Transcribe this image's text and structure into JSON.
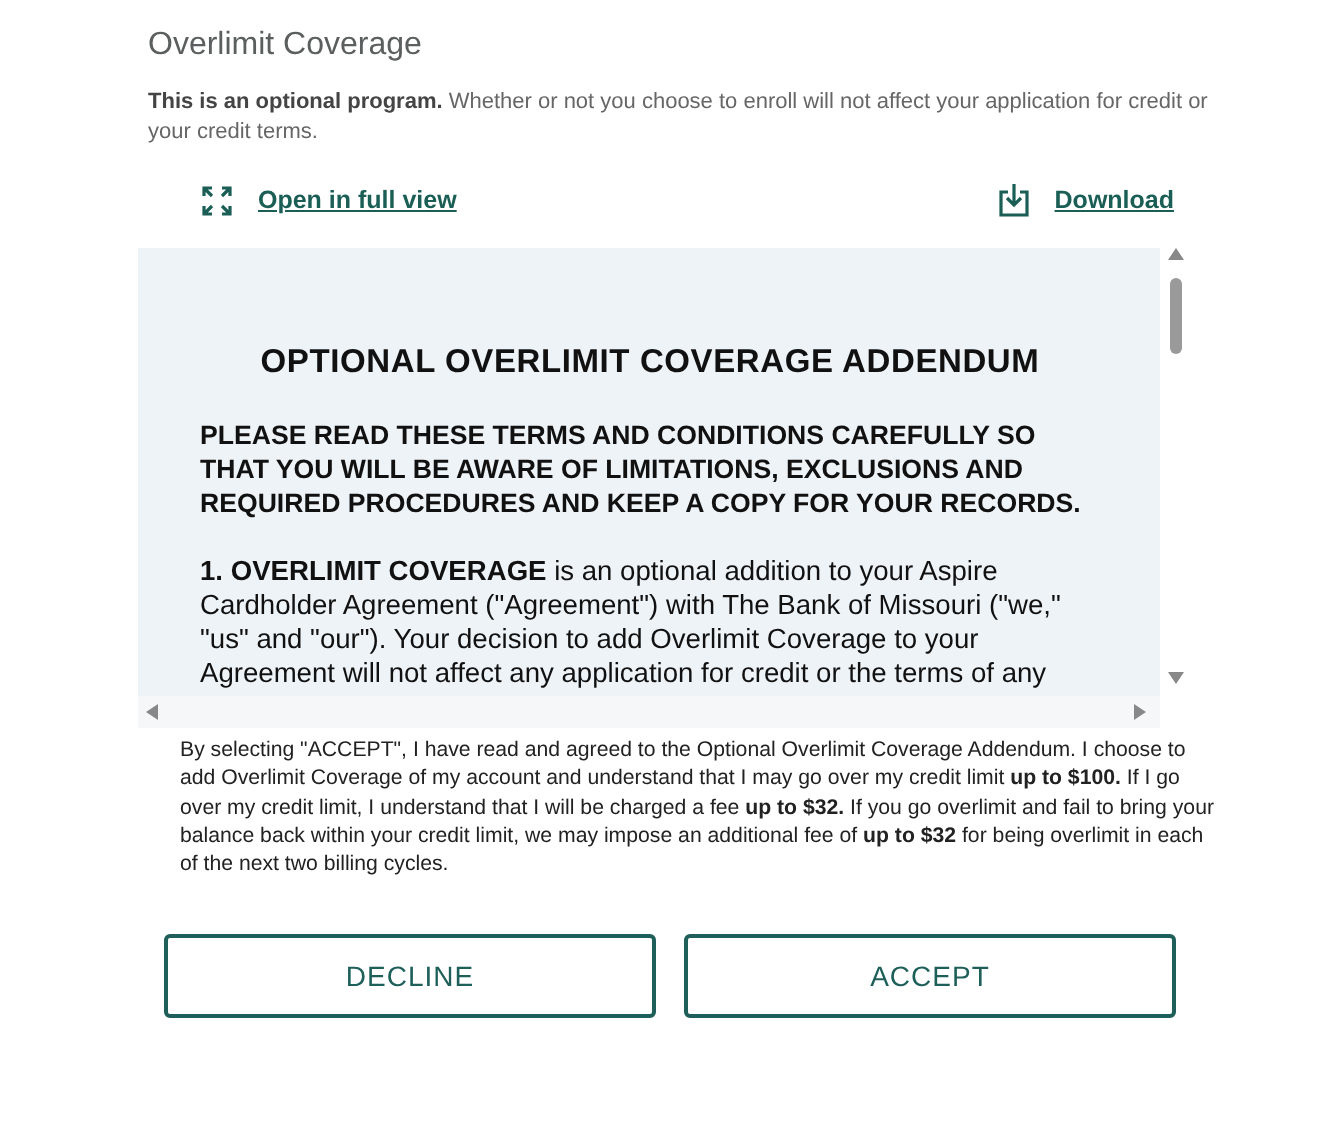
{
  "title": "Overlimit Coverage",
  "intro": "**This is an optional program.** Whether or not you choose to enroll will not affect your application for credit or your credit terms.",
  "links": [
    {
      "kind": "expand",
      "label": "Open in full view"
    },
    {
      "kind": "download",
      "label": "Download"
    }
  ],
  "document": {
    "heading": "OPTIONAL OVERLIMIT COVERAGE ADDENDUM",
    "notice": "PLEASE READ THESE TERMS AND CONDITIONS CAREFULLY SO THAT YOU WILL BE AWARE OF LIMITATIONS, EXCLUSIONS AND REQUIRED PROCEDURES AND KEEP A COPY FOR YOUR RECORDS.",
    "paragraph": "**1. OVERLIMIT COVERAGE** is an optional addition to your Aspire Cardholder Agreement (\"Agreement\") with The Bank of Missouri (\"we,\" \"us\" and \"our\"). Your decision to add Overlimit Coverage to your Agreement will not affect any application for credit or the terms of any"
  },
  "consent": "By selecting \"ACCEPT\", I have read and agreed to the Optional Overlimit Coverage Addendum. I choose to add Overlimit Coverage of my account and understand that I may go over my credit limit **up to $100.** If I go over my credit limit, I understand that I will be charged a fee **up to $32.** If you go overlimit and fail to bring your balance back within your credit limit, we may impose an additional fee of **up to $32** for being overlimit in each of the next two billing cycles.",
  "buttons": [
    "DECLINE",
    "ACCEPT"
  ]
}
